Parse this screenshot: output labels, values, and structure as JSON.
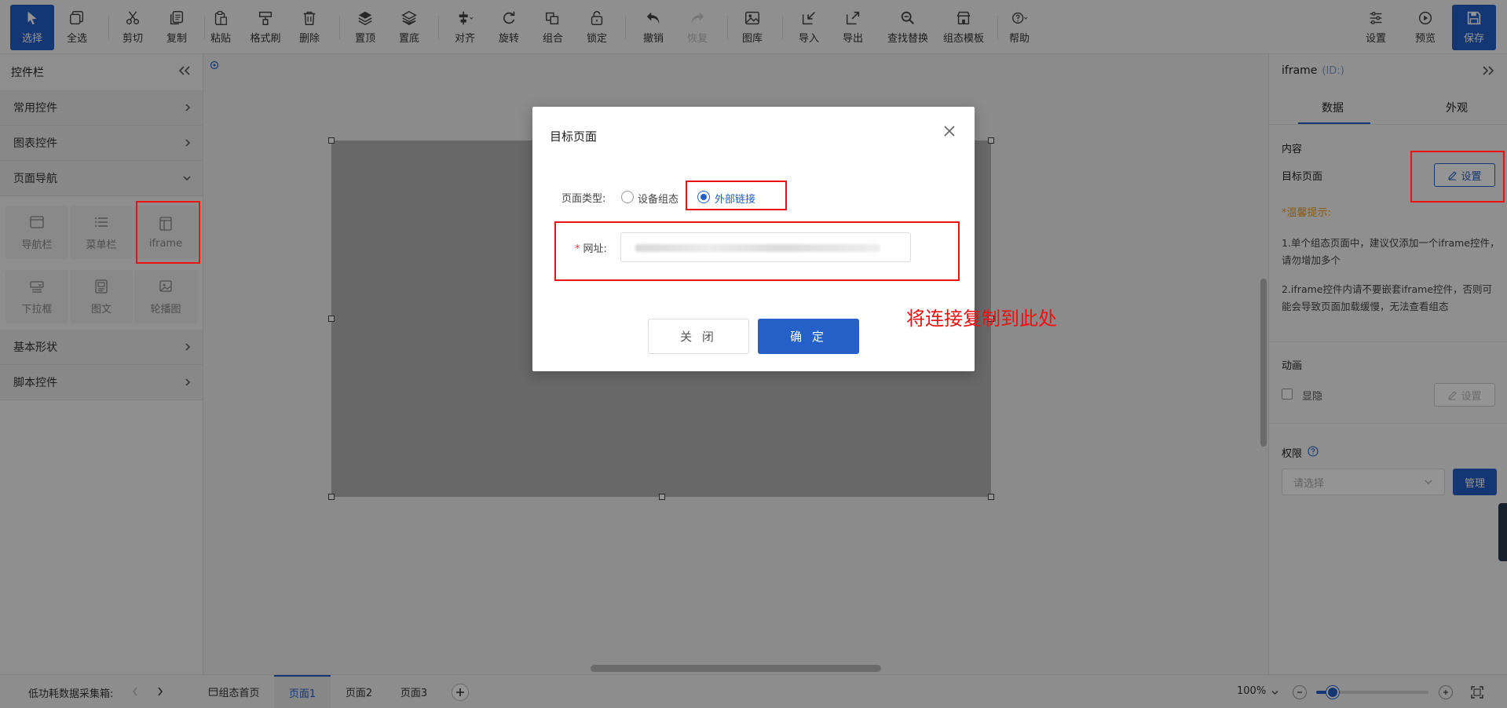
{
  "toolbar": {
    "items": [
      {
        "label": "选择",
        "icon": "cursor-icon"
      },
      {
        "label": "全选",
        "icon": "select-all-icon"
      },
      {
        "label": "剪切",
        "icon": "scissors-icon"
      },
      {
        "label": "复制",
        "icon": "copy-icon"
      },
      {
        "label": "粘贴",
        "icon": "paste-icon"
      },
      {
        "label": "格式刷",
        "icon": "format-brush-icon"
      },
      {
        "label": "删除",
        "icon": "trash-icon"
      },
      {
        "label": "置顶",
        "icon": "bring-front-icon"
      },
      {
        "label": "置底",
        "icon": "send-back-icon"
      },
      {
        "label": "对齐",
        "icon": "align-icon"
      },
      {
        "label": "旋转",
        "icon": "rotate-icon"
      },
      {
        "label": "组合",
        "icon": "group-icon"
      },
      {
        "label": "锁定",
        "icon": "lock-icon"
      },
      {
        "label": "撤销",
        "icon": "undo-icon"
      },
      {
        "label": "恢复",
        "icon": "redo-icon"
      },
      {
        "label": "图库",
        "icon": "image-library-icon"
      },
      {
        "label": "导入",
        "icon": "import-icon"
      },
      {
        "label": "导出",
        "icon": "export-icon"
      },
      {
        "label": "查找替换",
        "icon": "find-replace-icon"
      },
      {
        "label": "组态模板",
        "icon": "template-icon"
      },
      {
        "label": "帮助",
        "icon": "help-icon"
      },
      {
        "label": "设置",
        "icon": "settings-sliders-icon"
      },
      {
        "label": "预览",
        "icon": "preview-play-icon"
      },
      {
        "label": "保存",
        "icon": "save-icon"
      }
    ]
  },
  "left_panel": {
    "title": "控件栏",
    "categories": [
      {
        "label": "常用控件"
      },
      {
        "label": "图表控件"
      },
      {
        "label": "页面导航"
      },
      {
        "label": "基本形状"
      },
      {
        "label": "脚本控件"
      }
    ],
    "nav_items": [
      {
        "label": "导航栏",
        "icon": "navbar-icon"
      },
      {
        "label": "菜单栏",
        "icon": "menu-list-icon"
      },
      {
        "label": "iframe",
        "icon": "iframe-icon"
      },
      {
        "label": "下拉框",
        "icon": "dropdown-icon"
      },
      {
        "label": "图文",
        "icon": "image-text-icon"
      },
      {
        "label": "轮播图",
        "icon": "carousel-icon"
      }
    ]
  },
  "right_panel": {
    "title": "iframe",
    "id_label": "(ID:)",
    "tabs": [
      "数据",
      "外观"
    ],
    "content_heading": "内容",
    "target_page_label": "目标页面",
    "set_button": "设置",
    "tip_title": "*温馨提示:",
    "tip_1": "1.单个组态页面中，建议仅添加一个iframe控件，请勿增加多个",
    "tip_2": "2.iframe控件内请不要嵌套iframe控件，否则可能会导致页面加载缓慢，无法查看组态",
    "animation_heading": "动画",
    "show_hide_label": "显隐",
    "animation_set_button": "设置",
    "permission_heading": "权限",
    "permission_placeholder": "请选择",
    "manage_button": "管理"
  },
  "bottom_bar": {
    "device_label": "低功耗数据采集箱:",
    "home_tab": "组态首页",
    "pages": [
      {
        "label": "页面1",
        "active": true
      },
      {
        "label": "页面2",
        "active": false
      },
      {
        "label": "页面3",
        "active": false
      }
    ],
    "zoom_text": "100%",
    "zoom_level": 0.15
  },
  "modal": {
    "title": "目标页面",
    "page_type_label": "页面类型:",
    "option_device": "设备组态",
    "option_external": "外部链接",
    "selected_option": "外部链接",
    "url_label": "网址:",
    "url_value": "",
    "cancel_button": "关 闭",
    "ok_button": "确 定"
  },
  "annotation": {
    "text": "将连接复制到此处",
    "color": "#ee1111"
  },
  "colors": {
    "accent": "#2460c8",
    "warning": "#f0a020"
  }
}
